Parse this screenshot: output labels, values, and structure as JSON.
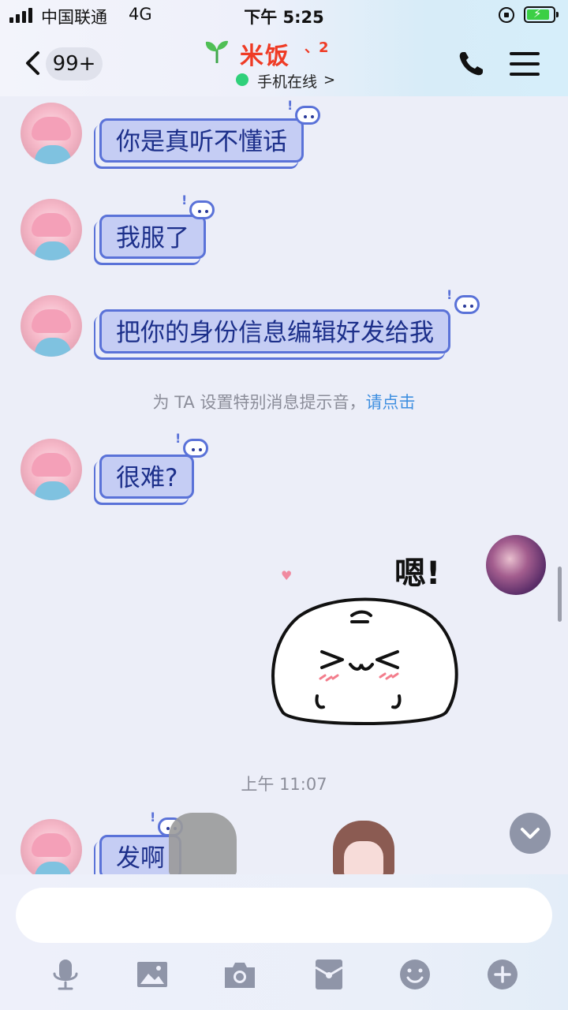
{
  "status_bar": {
    "carrier": "中国联通",
    "network": "4G",
    "time": "下午 5:25"
  },
  "header": {
    "unread_count": "99+",
    "contact_name": "米饭",
    "level_badge": "、2",
    "online_status": "手机在线",
    "name_color": "#ef3b25"
  },
  "messages": [
    {
      "side": "left",
      "text": "你是真听不懂话"
    },
    {
      "side": "left",
      "text": "我服了"
    },
    {
      "side": "left",
      "text": "把你的身份信息编辑好发给我"
    },
    {
      "side": "left",
      "text": "很难?"
    },
    {
      "side": "left",
      "text": "发啊"
    }
  ],
  "system_tip": {
    "text": "为 TA 设置特别消息提示音，",
    "link": "请点击"
  },
  "sticker": {
    "caption": "嗯!"
  },
  "time_label": "上午 11:07",
  "icons": {
    "toolbar": [
      "microphone-icon",
      "image-icon",
      "camera-icon",
      "red-packet-icon",
      "emoji-icon",
      "plus-icon"
    ]
  },
  "colors": {
    "bubble_fill": "#c5cdf4",
    "bubble_border": "#5a72d8",
    "bubble_text": "#1c2f8a",
    "link": "#3f8fe0",
    "online": "#2fd07a"
  }
}
